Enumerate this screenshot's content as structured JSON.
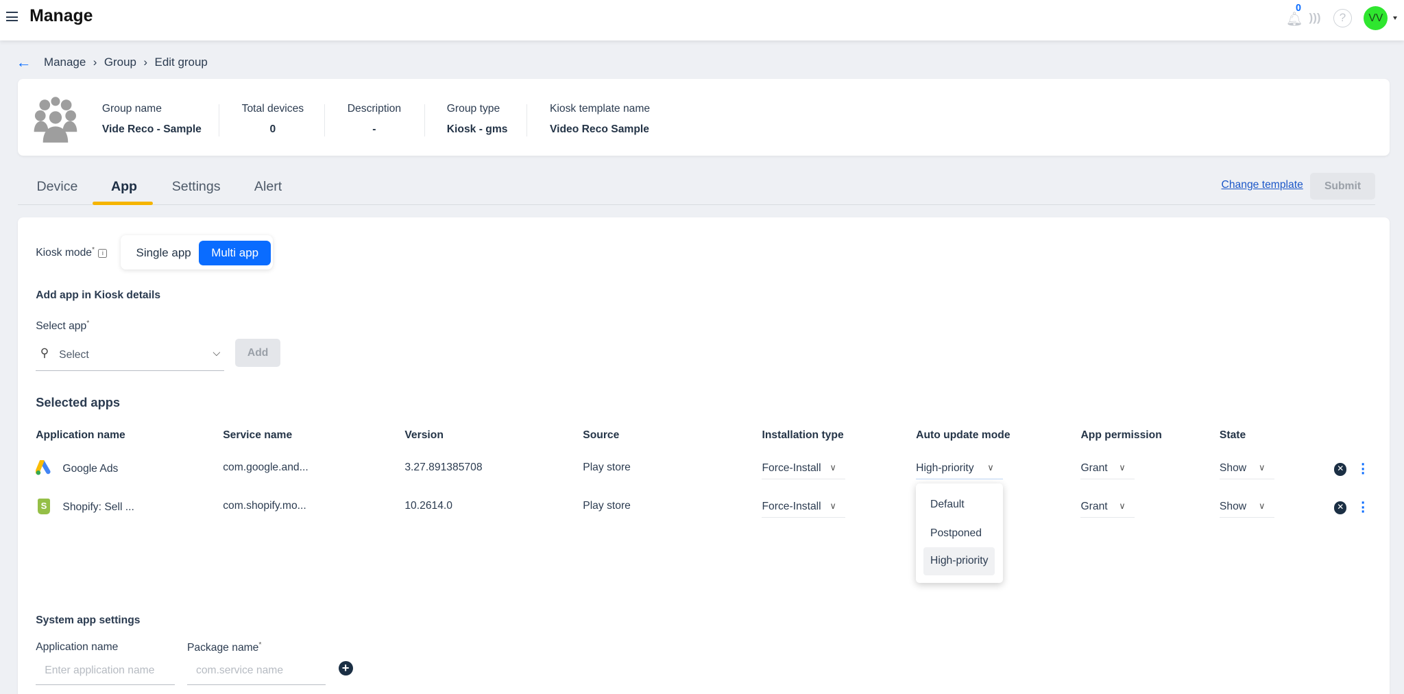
{
  "header": {
    "title": "Manage",
    "notification_count": "0",
    "avatar_initials": "VV"
  },
  "breadcrumb": [
    "Manage",
    "Group",
    "Edit group"
  ],
  "group_info": {
    "fields": [
      {
        "label": "Group name",
        "value": "Vide Reco - Sample"
      },
      {
        "label": "Total devices",
        "value": "0"
      },
      {
        "label": "Description",
        "value": "-"
      },
      {
        "label": "Group type",
        "value": "Kiosk - gms"
      },
      {
        "label": "Kiosk template name",
        "value": "Video Reco Sample"
      }
    ]
  },
  "tabs": [
    "Device",
    "App",
    "Settings",
    "Alert"
  ],
  "active_tab": "App",
  "actions": {
    "change_template": "Change template",
    "submit": "Submit"
  },
  "kiosk": {
    "label": "Kiosk mode",
    "options": [
      "Single app",
      "Multi app"
    ],
    "selected": "Multi app"
  },
  "add_app": {
    "heading": "Add app in Kiosk details",
    "select_label": "Select app",
    "placeholder": "Select",
    "add": "Add"
  },
  "selected_apps": {
    "heading": "Selected apps",
    "columns": [
      "Application name",
      "Service name",
      "Version",
      "Source",
      "Installation type",
      "Auto update mode",
      "App permission",
      "State"
    ],
    "rows": [
      {
        "name": "Google Ads",
        "service": "com.google.and...",
        "version": "3.27.891385708",
        "source": "Play store",
        "install": "Force-Install",
        "update": "High-priority",
        "permission": "Grant",
        "state": "Show"
      },
      {
        "name": "Shopify: Sell ...",
        "service": "com.shopify.mo...",
        "version": "10.2614.0",
        "source": "Play store",
        "install": "Force-Install",
        "update": "",
        "permission": "Grant",
        "state": "Show"
      }
    ],
    "update_menu": [
      "Default",
      "Postponed",
      "High-priority"
    ],
    "update_menu_selected": "High-priority"
  },
  "system_app": {
    "heading": "System app settings",
    "app_label": "Application name",
    "app_placeholder": "Enter application name",
    "pkg_label": "Package name",
    "pkg_placeholder": "com.service name"
  },
  "colors": {
    "primary": "#0a6cff",
    "tab_underline": "#f5b400",
    "avatar": "#2fe62f"
  }
}
